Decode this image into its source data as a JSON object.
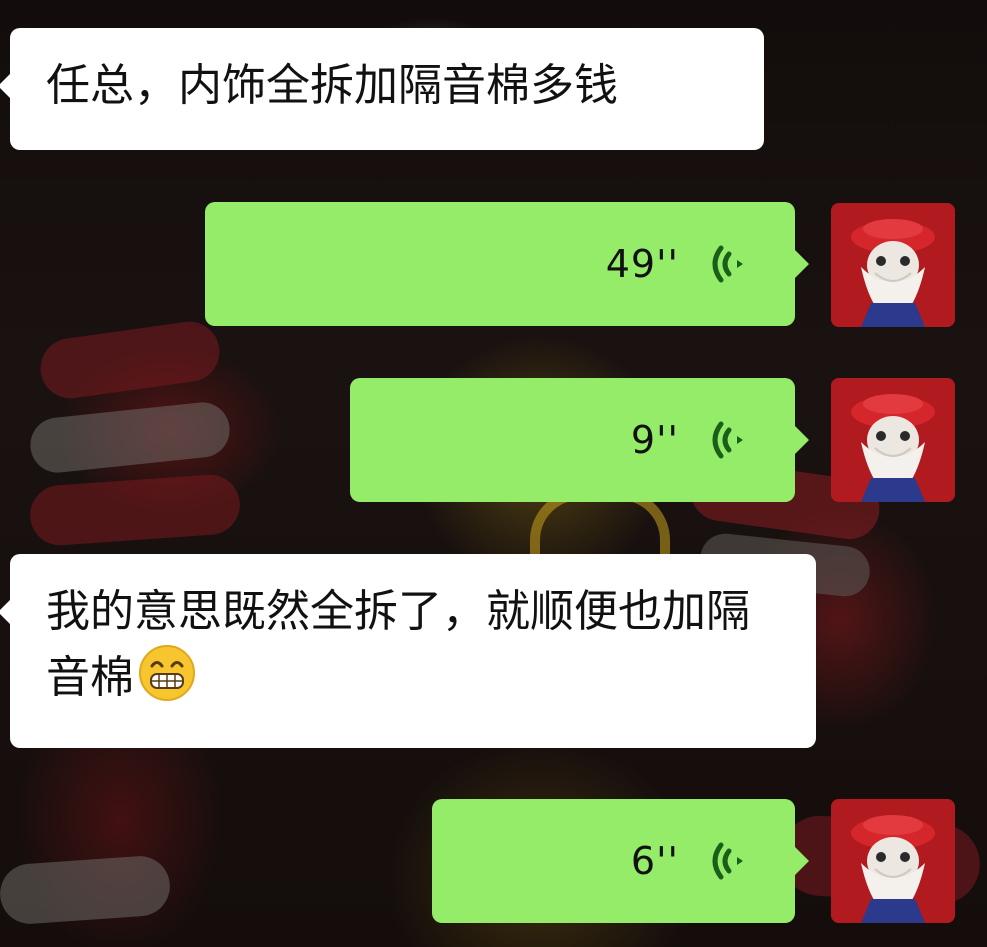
{
  "chat": {
    "messages": [
      {
        "side": "left",
        "type": "text",
        "text": "任总，内饰全拆加隔音棉多钱"
      },
      {
        "side": "right",
        "type": "voice",
        "duration": "49''"
      },
      {
        "side": "right",
        "type": "voice",
        "duration": "9''"
      },
      {
        "side": "left",
        "type": "text",
        "text": "我的意思既然全拆了，就顺便也加隔音棉",
        "emoji": "grinning-face-emoji"
      },
      {
        "side": "right",
        "type": "voice",
        "duration": "6''"
      }
    ]
  },
  "icons": {
    "voice": "voice-wave-icon",
    "avatar": "bearded-figure-avatar"
  },
  "colors": {
    "outgoing_bubble": "#95ec69",
    "incoming_bubble": "#ffffff",
    "avatar_background": "#b11a1e",
    "voice_icon": "#1b5e1b"
  }
}
